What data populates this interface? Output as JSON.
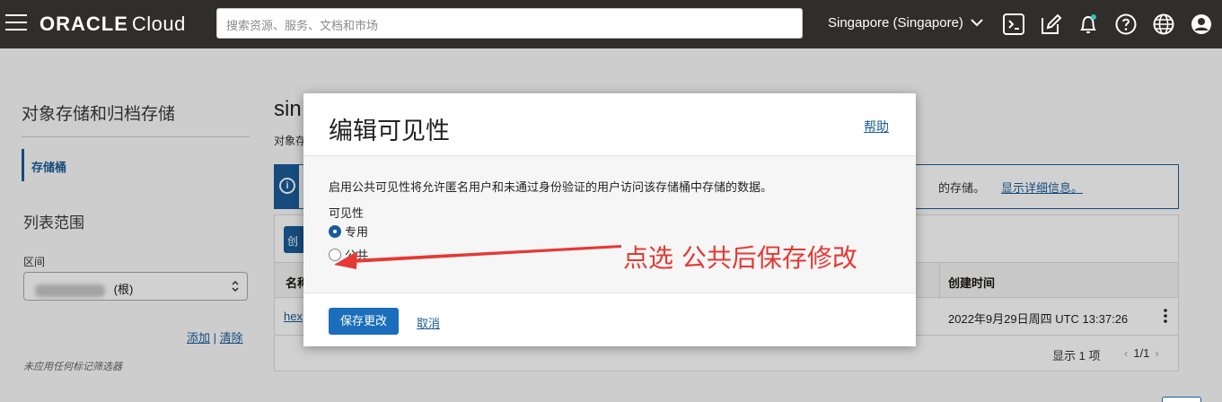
{
  "header": {
    "logo_bold": "ORACLE",
    "logo_light": "Cloud",
    "search_placeholder": "搜索资源、服务、文档和市场",
    "region": "Singapore (Singapore)",
    "icons": [
      "cloud-shell-icon",
      "edit-icon",
      "bell-icon",
      "help-icon",
      "globe-icon",
      "user-icon"
    ]
  },
  "sidebar": {
    "title": "对象存储和归档存储",
    "active_item": "存储桶",
    "scope_title": "列表范围",
    "zone_label": "区间",
    "zone_value": "(根)",
    "tag_add": "添加",
    "tag_sep": "|",
    "tag_clear": "清除",
    "no_filter": "未应用任何标记筛选器"
  },
  "main": {
    "title_partial": "sin",
    "subtitle_partial": "对象存",
    "banner_tail": "的存储。",
    "banner_link": "显示详细信息。",
    "create_btn_partial": "创",
    "col_name_partial": "名称",
    "col_created": "创建时间",
    "row_name_partial": "hex",
    "row_created": "2022年9月29日周四 UTC 13:37:26",
    "count": "显示 1 项",
    "page": "1/1"
  },
  "modal": {
    "title": "编辑可见性",
    "help": "帮助",
    "description": "启用公共可见性将允许匿名用户和未通过身份验证的用户访问该存储桶中存储的数据。",
    "visibility_label": "可见性",
    "options": [
      {
        "label": "专用",
        "selected": true
      },
      {
        "label": "公共",
        "selected": false
      }
    ],
    "save": "保存更改",
    "cancel": "取消"
  },
  "annotation": {
    "text": "点选 公共后保存修改",
    "color": "#e53935"
  },
  "colors": {
    "topbar": "#312d2a",
    "accent": "#1a5c99",
    "primary_button": "#1a6ebc"
  }
}
